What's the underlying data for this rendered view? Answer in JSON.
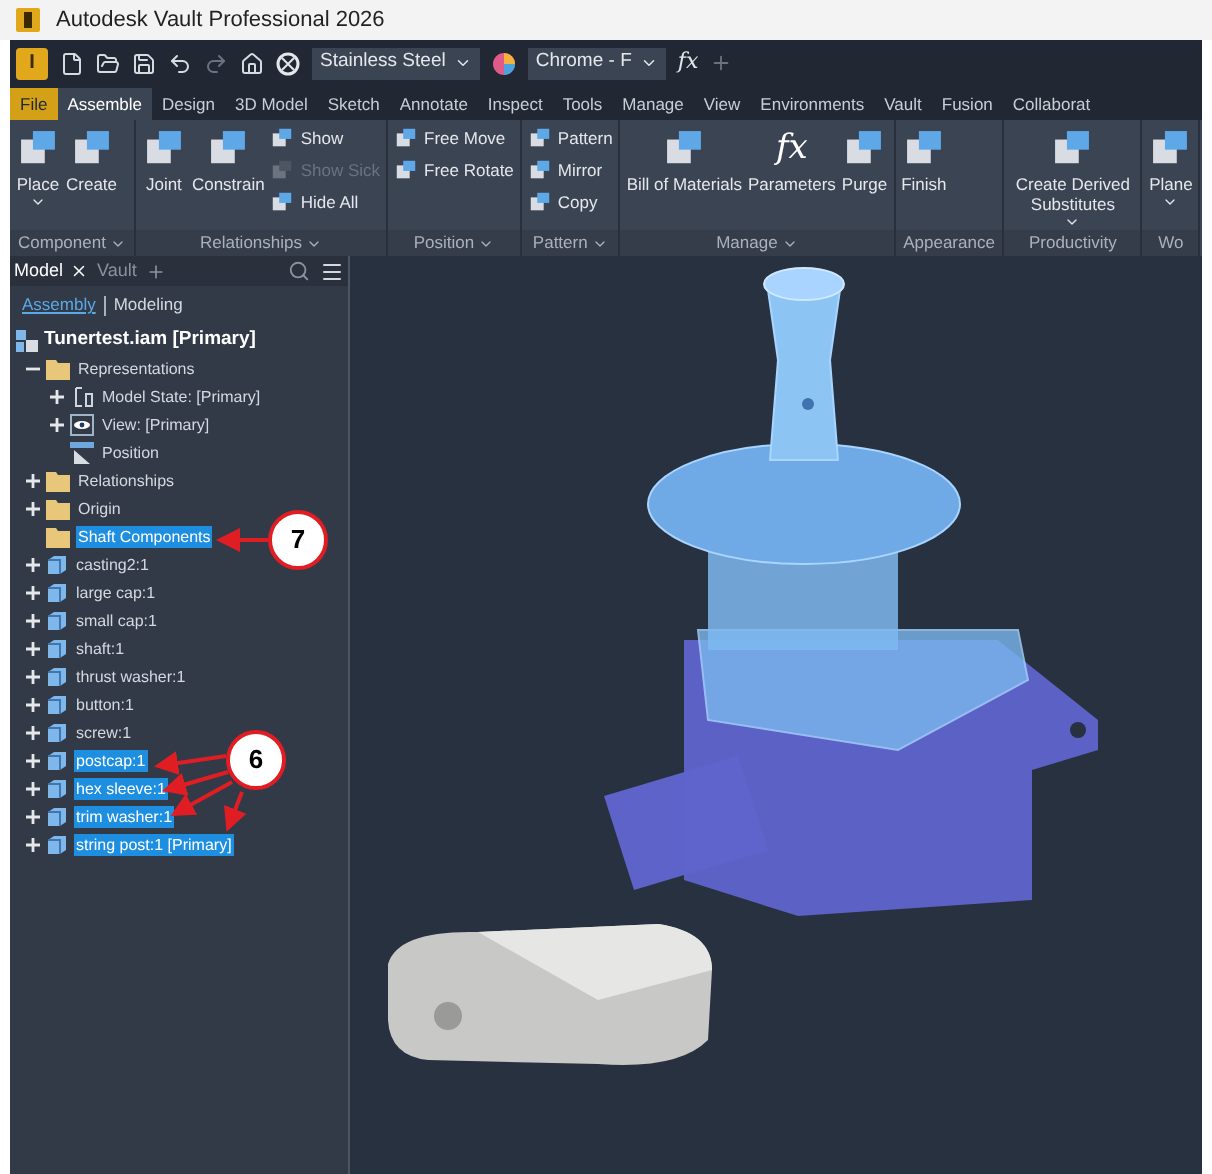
{
  "window": {
    "title": "Autodesk Vault Professional 2026"
  },
  "quick_access": {
    "app_badge": "I",
    "material": "Stainless Steel",
    "appearance": "Chrome - F",
    "fx_button": "fx"
  },
  "ribbon_tabs": [
    {
      "label": "File",
      "kind": "file",
      "selected": false
    },
    {
      "label": "Assemble",
      "kind": "tab",
      "selected": true
    },
    {
      "label": "Design",
      "kind": "tab",
      "selected": false
    },
    {
      "label": "3D Model",
      "kind": "tab",
      "selected": false
    },
    {
      "label": "Sketch",
      "kind": "tab",
      "selected": false
    },
    {
      "label": "Annotate",
      "kind": "tab",
      "selected": false
    },
    {
      "label": "Inspect",
      "kind": "tab",
      "selected": false
    },
    {
      "label": "Tools",
      "kind": "tab",
      "selected": false
    },
    {
      "label": "Manage",
      "kind": "tab",
      "selected": false
    },
    {
      "label": "View",
      "kind": "tab",
      "selected": false
    },
    {
      "label": "Environments",
      "kind": "tab",
      "selected": false
    },
    {
      "label": "Vault",
      "kind": "tab",
      "selected": false
    },
    {
      "label": "Fusion",
      "kind": "tab",
      "selected": false
    },
    {
      "label": "Collaborat",
      "kind": "tab",
      "selected": false
    }
  ],
  "ribbon_panels": [
    {
      "title": "Component",
      "menu": true,
      "tools": [
        {
          "label": "Place",
          "kind": "large",
          "menu": true,
          "disabled": false
        },
        {
          "label": "Create",
          "kind": "large",
          "menu": false,
          "disabled": false
        }
      ]
    },
    {
      "title": "Relationships",
      "menu": true,
      "tools": [
        {
          "label": "Joint",
          "kind": "large",
          "menu": false,
          "disabled": false
        },
        {
          "label": "Constrain",
          "kind": "large",
          "menu": false,
          "disabled": false
        },
        {
          "label": "Show",
          "kind": "small",
          "menu": false,
          "disabled": false
        },
        {
          "label": "Show Sick",
          "kind": "small",
          "menu": false,
          "disabled": true
        },
        {
          "label": "Hide All",
          "kind": "small",
          "menu": false,
          "disabled": false
        }
      ]
    },
    {
      "title": "Position",
      "menu": true,
      "tools": [
        {
          "label": "Free Move",
          "kind": "small",
          "menu": false,
          "disabled": false
        },
        {
          "label": "Free Rotate",
          "kind": "small",
          "menu": false,
          "disabled": false
        }
      ]
    },
    {
      "title": "Pattern",
      "menu": true,
      "tools": [
        {
          "label": "Pattern",
          "kind": "small",
          "menu": false,
          "disabled": false
        },
        {
          "label": "Mirror",
          "kind": "small",
          "menu": false,
          "disabled": false
        },
        {
          "label": "Copy",
          "kind": "small",
          "menu": false,
          "disabled": false
        }
      ]
    },
    {
      "title": "Manage",
      "menu": true,
      "tools": [
        {
          "label": "Bill of Materials",
          "kind": "large",
          "menu": false,
          "disabled": false
        },
        {
          "label": "Parameters",
          "kind": "glyph",
          "glyph": "fx",
          "menu": false,
          "disabled": false
        },
        {
          "label": "Purge",
          "kind": "large",
          "menu": false,
          "disabled": false
        }
      ]
    },
    {
      "title": "Appearance",
      "menu": false,
      "tools": [
        {
          "label": "Finish",
          "kind": "large",
          "menu": false,
          "disabled": false
        }
      ]
    },
    {
      "title": "Productivity",
      "menu": false,
      "tools": [
        {
          "label": "Create Derived Substitutes",
          "kind": "large",
          "menu": true,
          "disabled": false
        }
      ]
    },
    {
      "title": "Wo",
      "menu": false,
      "tools": [
        {
          "label": "Plane",
          "kind": "large",
          "menu": true,
          "disabled": false
        }
      ]
    }
  ],
  "browser": {
    "tabs": [
      {
        "label": "Model",
        "selected": true
      },
      {
        "label": "Vault",
        "selected": false
      }
    ],
    "modes": [
      {
        "label": "Assembly",
        "selected": true
      },
      {
        "label": "Modeling",
        "selected": false
      }
    ],
    "root": {
      "label": "Tunertest.iam [Primary]"
    },
    "items": [
      {
        "label": "Representations",
        "kind": "folder",
        "expander": true,
        "expanded": true,
        "selected": false,
        "children": [
          {
            "label": "Model State: [Primary]",
            "kind": "state",
            "expander": true,
            "expanded": false,
            "selected": false
          },
          {
            "label": "View: [Primary]",
            "kind": "view",
            "expander": true,
            "expanded": false,
            "selected": false
          },
          {
            "label": "Position",
            "kind": "position",
            "expander": false,
            "selected": false
          }
        ]
      },
      {
        "label": "Relationships",
        "kind": "folder",
        "expander": true,
        "expanded": false,
        "selected": false
      },
      {
        "label": "Origin",
        "kind": "folder",
        "expander": true,
        "expanded": false,
        "selected": false
      },
      {
        "label": "Shaft Components",
        "kind": "folder",
        "expander": false,
        "selected": true
      },
      {
        "label": "casting2:1",
        "kind": "part",
        "expander": true,
        "expanded": false,
        "selected": false
      },
      {
        "label": "large cap:1",
        "kind": "part",
        "expander": true,
        "expanded": false,
        "selected": false
      },
      {
        "label": "small cap:1",
        "kind": "part",
        "expander": true,
        "expanded": false,
        "selected": false
      },
      {
        "label": "shaft:1",
        "kind": "part",
        "expander": true,
        "expanded": false,
        "selected": false
      },
      {
        "label": "thrust washer:1",
        "kind": "part",
        "expander": true,
        "expanded": false,
        "selected": false
      },
      {
        "label": "button:1",
        "kind": "part",
        "expander": true,
        "expanded": false,
        "selected": false
      },
      {
        "label": "screw:1",
        "kind": "part",
        "expander": true,
        "expanded": false,
        "selected": false
      },
      {
        "label": "postcap:1",
        "kind": "part",
        "expander": true,
        "expanded": false,
        "selected": true
      },
      {
        "label": "hex sleeve:1",
        "kind": "part",
        "expander": true,
        "expanded": false,
        "selected": true
      },
      {
        "label": "trim washer:1",
        "kind": "part",
        "expander": true,
        "expanded": false,
        "selected": true
      },
      {
        "label": "string post:1 [Primary]",
        "kind": "part",
        "expander": true,
        "expanded": false,
        "selected": true
      }
    ]
  },
  "callouts": [
    {
      "label": "7"
    },
    {
      "label": "6"
    }
  ]
}
